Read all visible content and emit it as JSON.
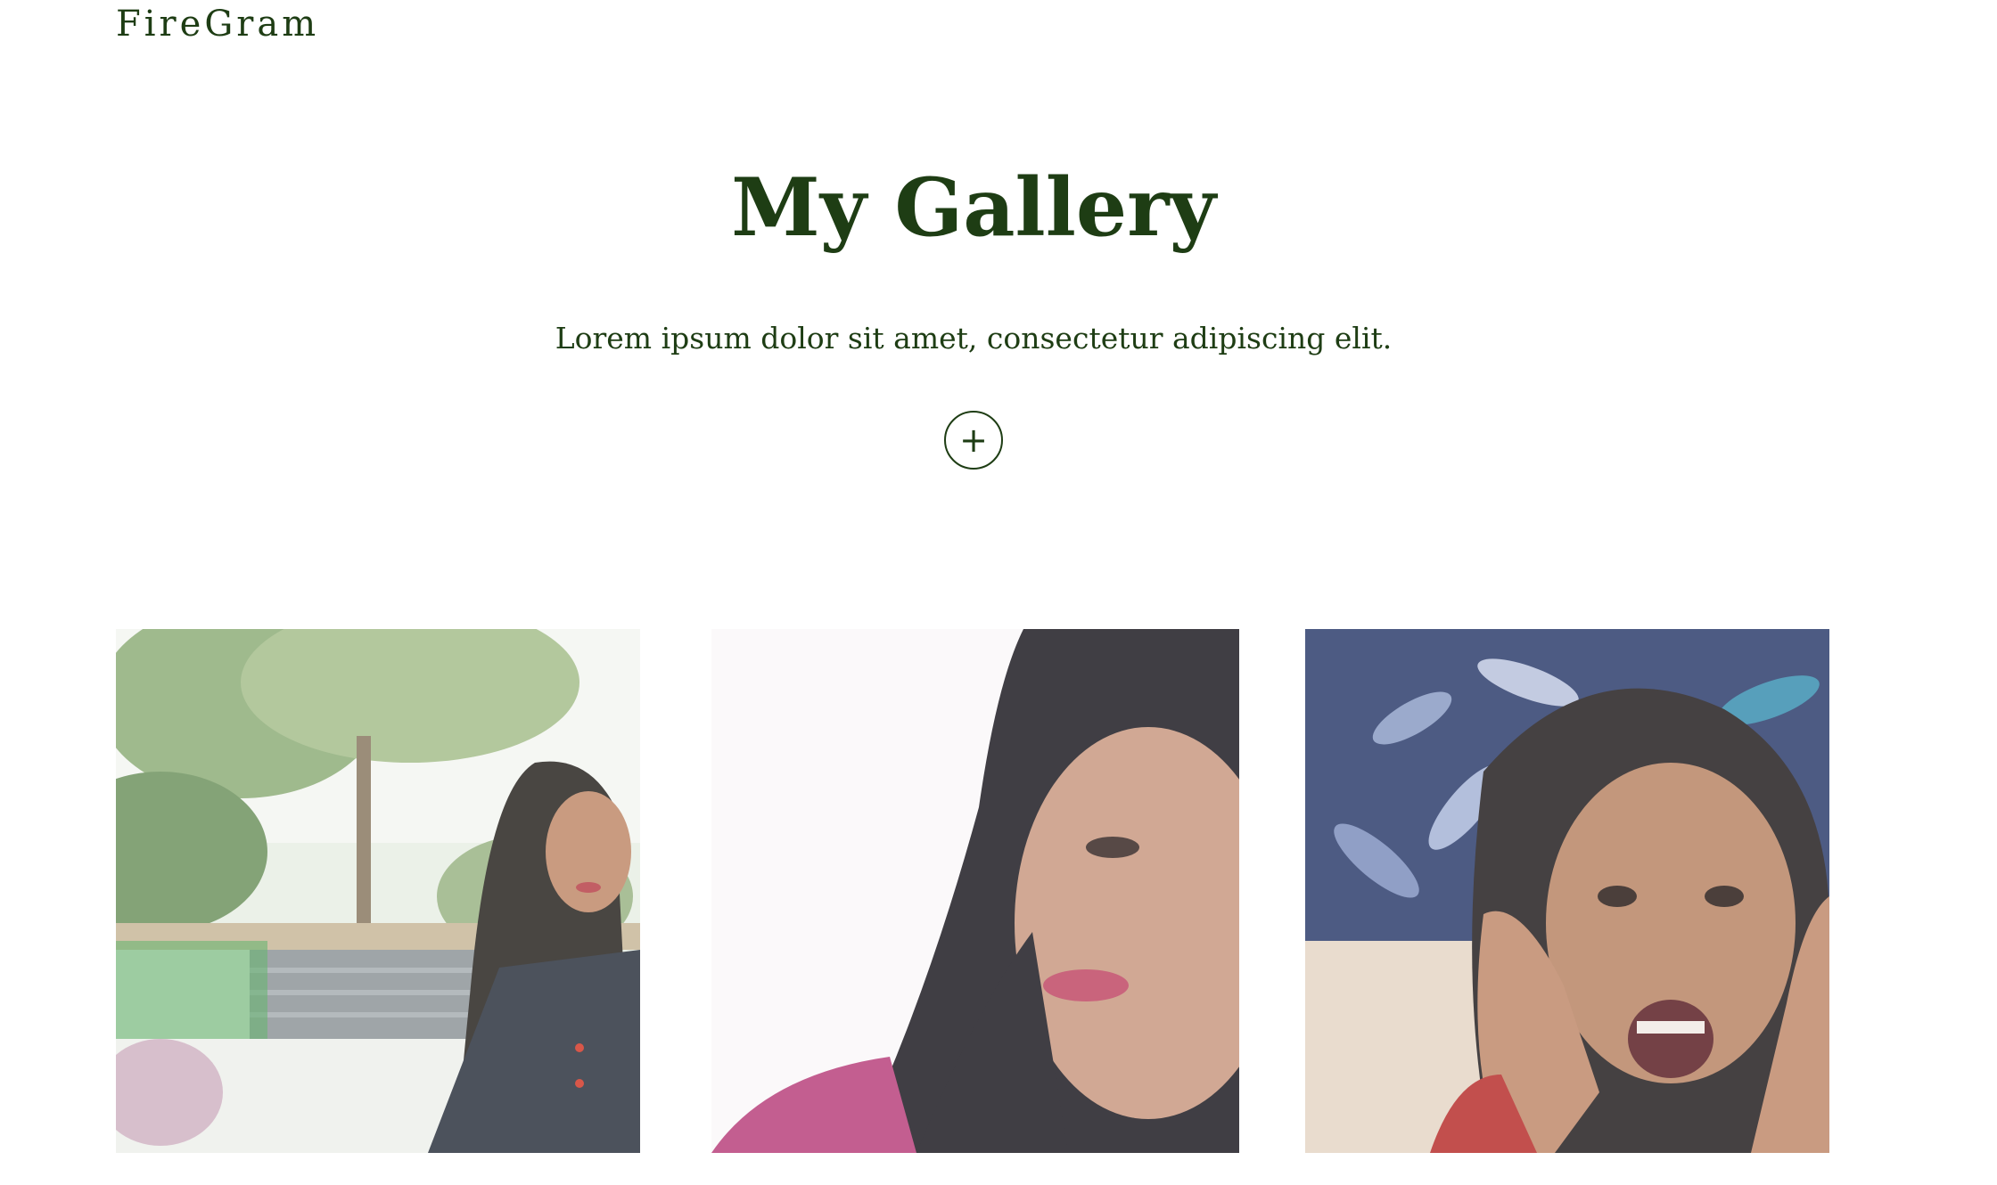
{
  "header": {
    "brand": "FireGram"
  },
  "main": {
    "title": "My Gallery",
    "subtitle": "Lorem ipsum dolor sit amet, consectetur adipiscing elit.",
    "upload_label": "+"
  },
  "gallery": {
    "images": [
      {
        "name": "photo-park"
      },
      {
        "name": "photo-closeup"
      },
      {
        "name": "photo-surprised"
      }
    ]
  }
}
